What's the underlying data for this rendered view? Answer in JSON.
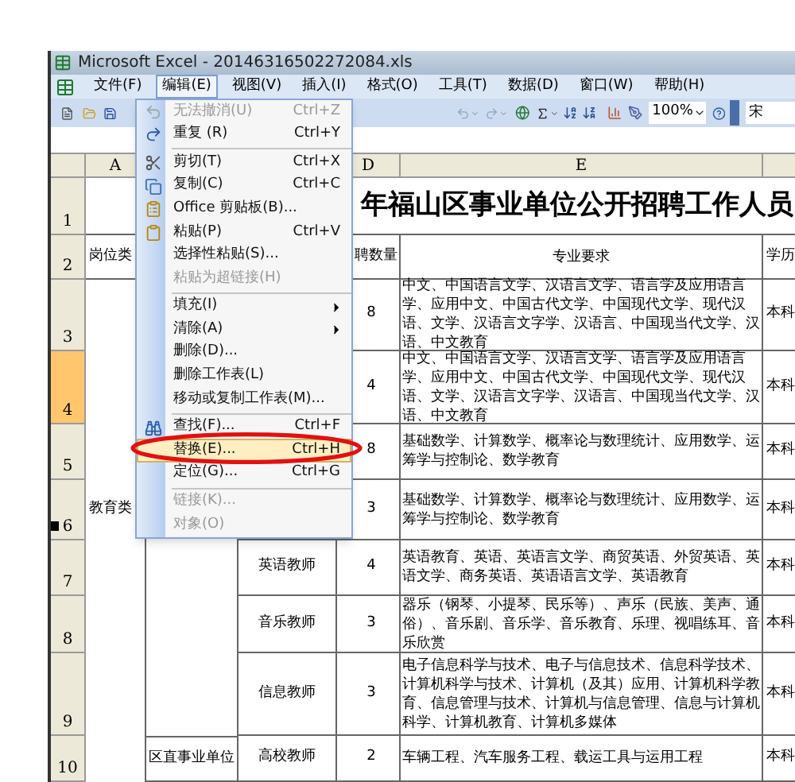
{
  "window": {
    "title": "Microsoft Excel - 20146316502272084.xls"
  },
  "menubar": [
    {
      "label": "文件(F)",
      "selected": false
    },
    {
      "label": "编辑(E)",
      "selected": true
    },
    {
      "label": "视图(V)",
      "selected": false
    },
    {
      "label": "插入(I)",
      "selected": false
    },
    {
      "label": "格式(O)",
      "selected": false
    },
    {
      "label": "工具(T)",
      "selected": false
    },
    {
      "label": "数据(D)",
      "selected": false
    },
    {
      "label": "窗口(W)",
      "selected": false
    },
    {
      "label": "帮助(H)",
      "selected": false
    }
  ],
  "toolbar": {
    "zoom": "100%",
    "font": "宋"
  },
  "edit_menu": [
    {
      "kind": "item",
      "label": "无法撤消(U)",
      "shortcut": "Ctrl+Z",
      "disabled": true,
      "selected": false
    },
    {
      "kind": "item",
      "label": "重复 (R)",
      "shortcut": "Ctrl+Y",
      "disabled": false,
      "selected": false
    },
    {
      "kind": "separator"
    },
    {
      "kind": "item",
      "label": "剪切(T)",
      "shortcut": "Ctrl+X",
      "disabled": false,
      "selected": false
    },
    {
      "kind": "item",
      "label": "复制(C)",
      "shortcut": "Ctrl+C",
      "disabled": false,
      "selected": false
    },
    {
      "kind": "item",
      "label": "Office 剪贴板(B)...",
      "disabled": false,
      "selected": false
    },
    {
      "kind": "item",
      "label": "粘贴(P)",
      "shortcut": "Ctrl+V",
      "disabled": false,
      "selected": false
    },
    {
      "kind": "item",
      "label": "选择性粘贴(S)...",
      "disabled": false,
      "selected": false
    },
    {
      "kind": "item",
      "label": "粘贴为超链接(H)",
      "disabled": true,
      "selected": false
    },
    {
      "kind": "separator"
    },
    {
      "kind": "item",
      "label": "填充(I)",
      "submenu": true,
      "disabled": false,
      "selected": false
    },
    {
      "kind": "item",
      "label": "清除(A)",
      "submenu": true,
      "disabled": false,
      "selected": false
    },
    {
      "kind": "item",
      "label": "删除(D)...",
      "disabled": false,
      "selected": false
    },
    {
      "kind": "item",
      "label": "删除工作表(L)",
      "disabled": false,
      "selected": false
    },
    {
      "kind": "item",
      "label": "移动或复制工作表(M)...",
      "disabled": false,
      "selected": false
    },
    {
      "kind": "separator"
    },
    {
      "kind": "item",
      "label": "查找(F)...",
      "shortcut": "Ctrl+F",
      "disabled": false,
      "selected": false
    },
    {
      "kind": "item",
      "label": "替换(E)...",
      "shortcut": "Ctrl+H",
      "disabled": false,
      "selected": true
    },
    {
      "kind": "item",
      "label": "定位(G)...",
      "shortcut": "Ctrl+G",
      "disabled": false,
      "selected": false
    },
    {
      "kind": "separator"
    },
    {
      "kind": "item",
      "label": "链接(K)...",
      "disabled": true,
      "selected": false
    },
    {
      "kind": "item",
      "label": "对象(O)",
      "disabled": true,
      "selected": false
    }
  ],
  "sheet": {
    "column_headers": [
      "A",
      "D",
      "E"
    ],
    "title": "年福山区事业单位公开招聘工作人员",
    "rows": [
      {
        "number": "1",
        "selected": false
      },
      {
        "number": "2",
        "selected": false,
        "a": "岗位类",
        "d": "聘数量",
        "e": "专业要求",
        "f": "学历"
      },
      {
        "number": "3",
        "selected": false,
        "d": "8",
        "e": "中文、中国语言文学、汉语言文学、语言学及应用语言学、应用中文、中国古代文学、中国现代文学、现代汉语、文学、汉语言文字学、汉语言、中国现当代文学、汉语、中文教育",
        "f": "本科"
      },
      {
        "number": "4",
        "selected": true,
        "d": "4",
        "e": "中文、中国语言文学、汉语言文学、语言学及应用语言学、应用中文、中国古代文学、中国现代文学、现代汉语、文学、汉语言文字学、汉语言、中国现当代文学、汉语、中文教育",
        "f": "本科"
      },
      {
        "number": "5",
        "selected": false,
        "d": "8",
        "e": "基础数学、计算数学、概率论与数理统计、应用数学、运筹学与控制论、数学教育",
        "f": "本科"
      },
      {
        "number": "6",
        "selected": false,
        "a": "教育类",
        "d": "3",
        "e": "基础数学、计算数学、概率论与数理统计、应用数学、运筹学与控制论、数学教育",
        "f": "本科"
      },
      {
        "number": "7",
        "selected": false,
        "c": "英语教师",
        "d": "4",
        "e": "英语教育、英语、英语言文学、商贸英语、外贸英语、英语文学、商务英语、英语语言文学、英语教育",
        "f": "本科"
      },
      {
        "number": "8",
        "selected": false,
        "c": "音乐教师",
        "d": "3",
        "e": "器乐（钢琴、小提琴、民乐等）、声乐（民族、美声、通俗）、音乐剧、音乐学、音乐教育、乐理、视唱练耳、音乐欣赏",
        "f": "本科"
      },
      {
        "number": "9",
        "selected": false,
        "c": "信息教师",
        "d": "3",
        "e": "电子信息科学与技术、电子与信息技术、信息科学技术、计算机科学与技术、计算机（及其）应用、计算机科学教育、信息管理与技术、计算机与信息管理、信息与计算机科学、计算机教育、计算机多媒体",
        "f": "本科"
      },
      {
        "number": "10",
        "selected": false,
        "b": "区直事业单位",
        "c": "高校教师",
        "d": "2",
        "e": "车辆工程、汽车服务工程、载运工具与运用工程",
        "f": "本科"
      }
    ]
  }
}
